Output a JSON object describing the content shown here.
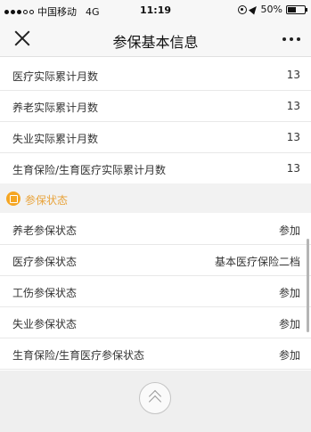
{
  "status_bar": {
    "carrier": "中国移动",
    "network": "4G",
    "time": "11:19",
    "battery": "50%"
  },
  "nav": {
    "title": "参保基本信息"
  },
  "counts": [
    {
      "label": "医疗实际累计月数",
      "value": "13"
    },
    {
      "label": "养老实际累计月数",
      "value": "13"
    },
    {
      "label": "失业实际累计月数",
      "value": "13"
    },
    {
      "label": "生育保险/生育医疗实际累计月数",
      "value": "13"
    }
  ],
  "status_section": {
    "title": "参保状态",
    "items": [
      {
        "label": "养老参保状态",
        "value": "参加"
      },
      {
        "label": "医疗参保状态",
        "value": "基本医疗保险二档"
      },
      {
        "label": "工伤参保状态",
        "value": "参加"
      },
      {
        "label": "失业参保状态",
        "value": "参加"
      },
      {
        "label": "生育保险/生育医疗参保状态",
        "value": "参加"
      }
    ]
  },
  "colors": {
    "accent": "#f5a623",
    "section_text": "#e8a33b"
  }
}
